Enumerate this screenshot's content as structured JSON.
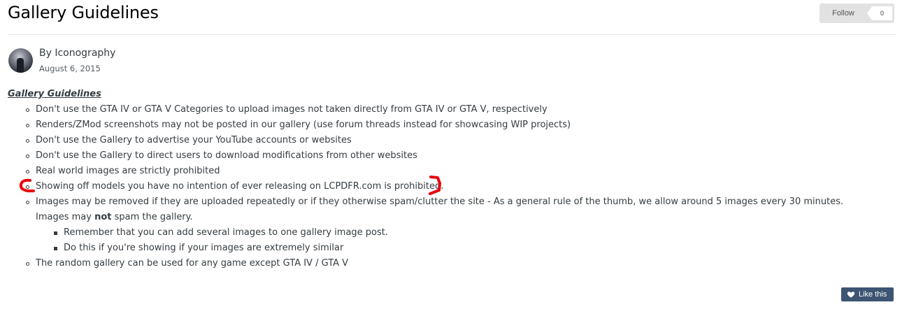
{
  "page": {
    "title": "Gallery Guidelines",
    "follow_label": "Follow",
    "follow_count": "0"
  },
  "post": {
    "author": "By Iconography",
    "date": "August 6, 2015",
    "heading": "Gallery Guidelines",
    "items": [
      "Don't use the GTA IV or GTA V Categories to upload images not taken directly from GTA IV or GTA V, respectively",
      "Renders/ZMod screenshots may not be posted in our gallery (use forum threads instead for showcasing WIP projects)",
      "Don't use the Gallery to advertise your YouTube accounts or websites",
      "Don't use the Gallery to direct users to download modifications from other websites",
      "Real world images are strictly prohibited",
      "Showing off models you have no intention of ever releasing on LCPDFR.com is prohibited."
    ],
    "item7": {
      "part1": "Images may be removed if they are uploaded repeatedly or if they otherwise spam/clutter the site - As a general rule of the thumb, we allow around 5 images every 30 minutes. Images may ",
      "bold": "not",
      "part2": " spam the gallery."
    },
    "subitems": [
      "Remember that you can add several images to one gallery image post.",
      "Do this if you're showing if your images are extremely similar"
    ],
    "last_item": "The random gallery can be used for any game except GTA IV / GTA V",
    "like_label": "Like this"
  },
  "colors": {
    "like_button_bg": "#3d5472",
    "annotation_red": "#e8000a"
  },
  "icons": {
    "avatar": "avatar",
    "like": "heart-icon"
  }
}
